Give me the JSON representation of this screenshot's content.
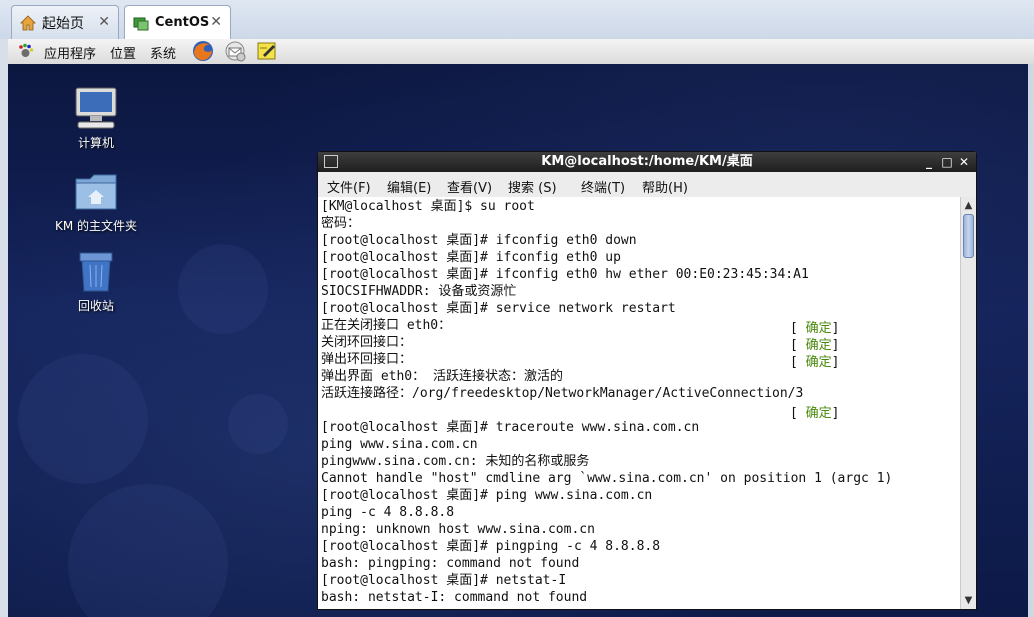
{
  "browser": {
    "tabs": [
      {
        "label": "起始页",
        "icon": "home-icon"
      },
      {
        "label": "CentOS",
        "icon": "vm-icon",
        "active": true
      }
    ],
    "close_glyph": "✕"
  },
  "panel": {
    "menus": [
      "应用程序",
      "位置",
      "系统"
    ],
    "launchers": [
      "firefox-icon",
      "mail-icon",
      "notes-icon"
    ]
  },
  "desktop": {
    "icons": [
      {
        "label": "计算机",
        "icon": "computer-icon"
      },
      {
        "label": "KM 的主文件夹",
        "icon": "home-folder-icon"
      },
      {
        "label": "回收站",
        "icon": "trash-icon"
      }
    ]
  },
  "terminal": {
    "title": "KM@localhost:/home/KM/桌面",
    "menus": [
      "文件(F)",
      "编辑(E)",
      "查看(V)",
      "搜索 (S)",
      "终端(T)",
      "帮助(H)"
    ],
    "buttons": {
      "minimize": "_",
      "maximize": "□",
      "close": "✕"
    },
    "lines": [
      "[KM@localhost 桌面]$ su root",
      "密码：",
      "[root@localhost 桌面]# ifconfig eth0 down",
      "[root@localhost 桌面]# ifconfig eth0 up",
      "[root@localhost 桌面]# ifconfig eth0 hw ether 00:E0:23:45:34:A1",
      "SIOCSIFHWADDR: 设备或资源忙",
      "[root@localhost 桌面]# service network restart",
      "正在关闭接口 eth0：",
      "关闭环回接口：",
      "弹出环回接口：",
      "弹出界面 eth0： 活跃连接状态：激活的",
      "活跃连接路径：/org/freedesktop/NetworkManager/ActiveConnection/3",
      "",
      "[root@localhost 桌面]# traceroute www.sina.com.cn",
      "ping www.sina.com.cn",
      "pingwww.sina.com.cn: 未知的名称或服务",
      "Cannot handle \"host\" cmdline arg `www.sina.com.cn' on position 1 (argc 1)",
      "[root@localhost 桌面]# ping www.sina.com.cn",
      "ping -c 4 8.8.8.8",
      "nping: unknown host www.sina.com.cn",
      "[root@localhost 桌面]# pingping -c 4 8.8.8.8",
      "bash: pingping: command not found",
      "[root@localhost 桌面]# netstat-I",
      "bash: netstat-I: command not found"
    ],
    "ok_label": "确定",
    "ok_lines": [
      7,
      8,
      9,
      12
    ],
    "colors": {
      "ok": "#4a8a0c"
    }
  }
}
